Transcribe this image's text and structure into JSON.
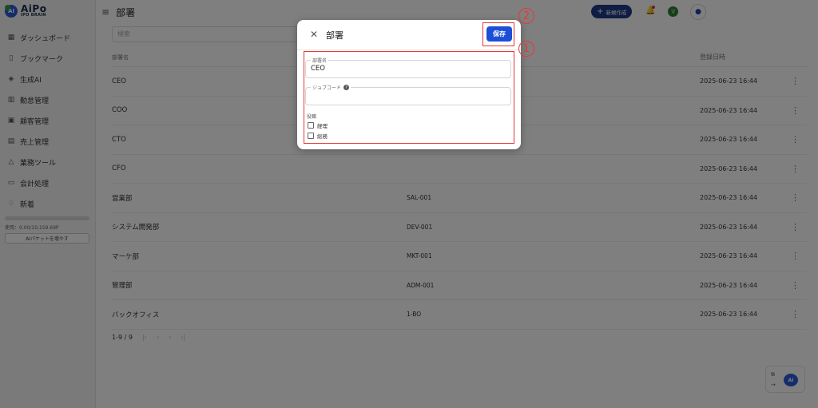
{
  "sidebar": {
    "logo_name": "AiPo",
    "logo_sub": "IPO BRAIN",
    "logo_badge": "AI",
    "items": [
      {
        "label": "ダッシュボード",
        "icon": "grid-icon"
      },
      {
        "label": "ブックマーク",
        "icon": "bookmark-icon"
      },
      {
        "label": "生成AI",
        "icon": "graduation-cap-icon"
      },
      {
        "label": "勤怠管理",
        "icon": "building-icon"
      },
      {
        "label": "顧客管理",
        "icon": "briefcase-icon"
      },
      {
        "label": "売上管理",
        "icon": "receipt-icon"
      },
      {
        "label": "業務ツール",
        "icon": "shapes-icon"
      },
      {
        "label": "会計処理",
        "icon": "wallet-icon"
      },
      {
        "label": "新着",
        "icon": "bell-plus-icon"
      }
    ],
    "usage_text": "使用：0.00/10,159.69P",
    "usage_fraction": 0.0,
    "usage_button": "AIパケットを増やす"
  },
  "header": {
    "title": "部署",
    "new_button": "新規作成",
    "avatar_letter": "マ"
  },
  "search": {
    "placeholder": "検索"
  },
  "table": {
    "columns": {
      "name": "部署名",
      "date": "登録日時"
    },
    "rows": [
      {
        "name": "CEO",
        "code": "",
        "date": "2025-06-23 16:44"
      },
      {
        "name": "COO",
        "code": "",
        "date": "2025-06-23 16:44"
      },
      {
        "name": "CTO",
        "code": "",
        "date": "2025-06-23 16:44"
      },
      {
        "name": "CFO",
        "code": "",
        "date": "2025-06-23 16:44"
      },
      {
        "name": "営業部",
        "code": "SAL-001",
        "date": "2025-06-23 16:44"
      },
      {
        "name": "システム開発部",
        "code": "DEV-001",
        "date": "2025-06-23 16:44"
      },
      {
        "name": "マーケ部",
        "code": "MKT-001",
        "date": "2025-06-23 16:44"
      },
      {
        "name": "管理部",
        "code": "ADM-001",
        "date": "2025-06-23 16:44"
      },
      {
        "name": "バックオフィス",
        "code": "1-BO",
        "date": "2025-06-23 16:44"
      }
    ],
    "pagination": "1-9 / 9"
  },
  "dialog": {
    "title": "部署",
    "save_button": "保存",
    "name_label": "部署名",
    "name_value": "CEO",
    "jobcode_label": "ジョブコード",
    "jobcode_value": "",
    "position_label": "役職",
    "positions": [
      "経理",
      "総務"
    ]
  },
  "annotations": {
    "first": "1",
    "second": "2"
  },
  "colors": {
    "accent": "#1d4ed8",
    "annotation": "#e53935",
    "brand_dark": "#1e3a8a"
  }
}
